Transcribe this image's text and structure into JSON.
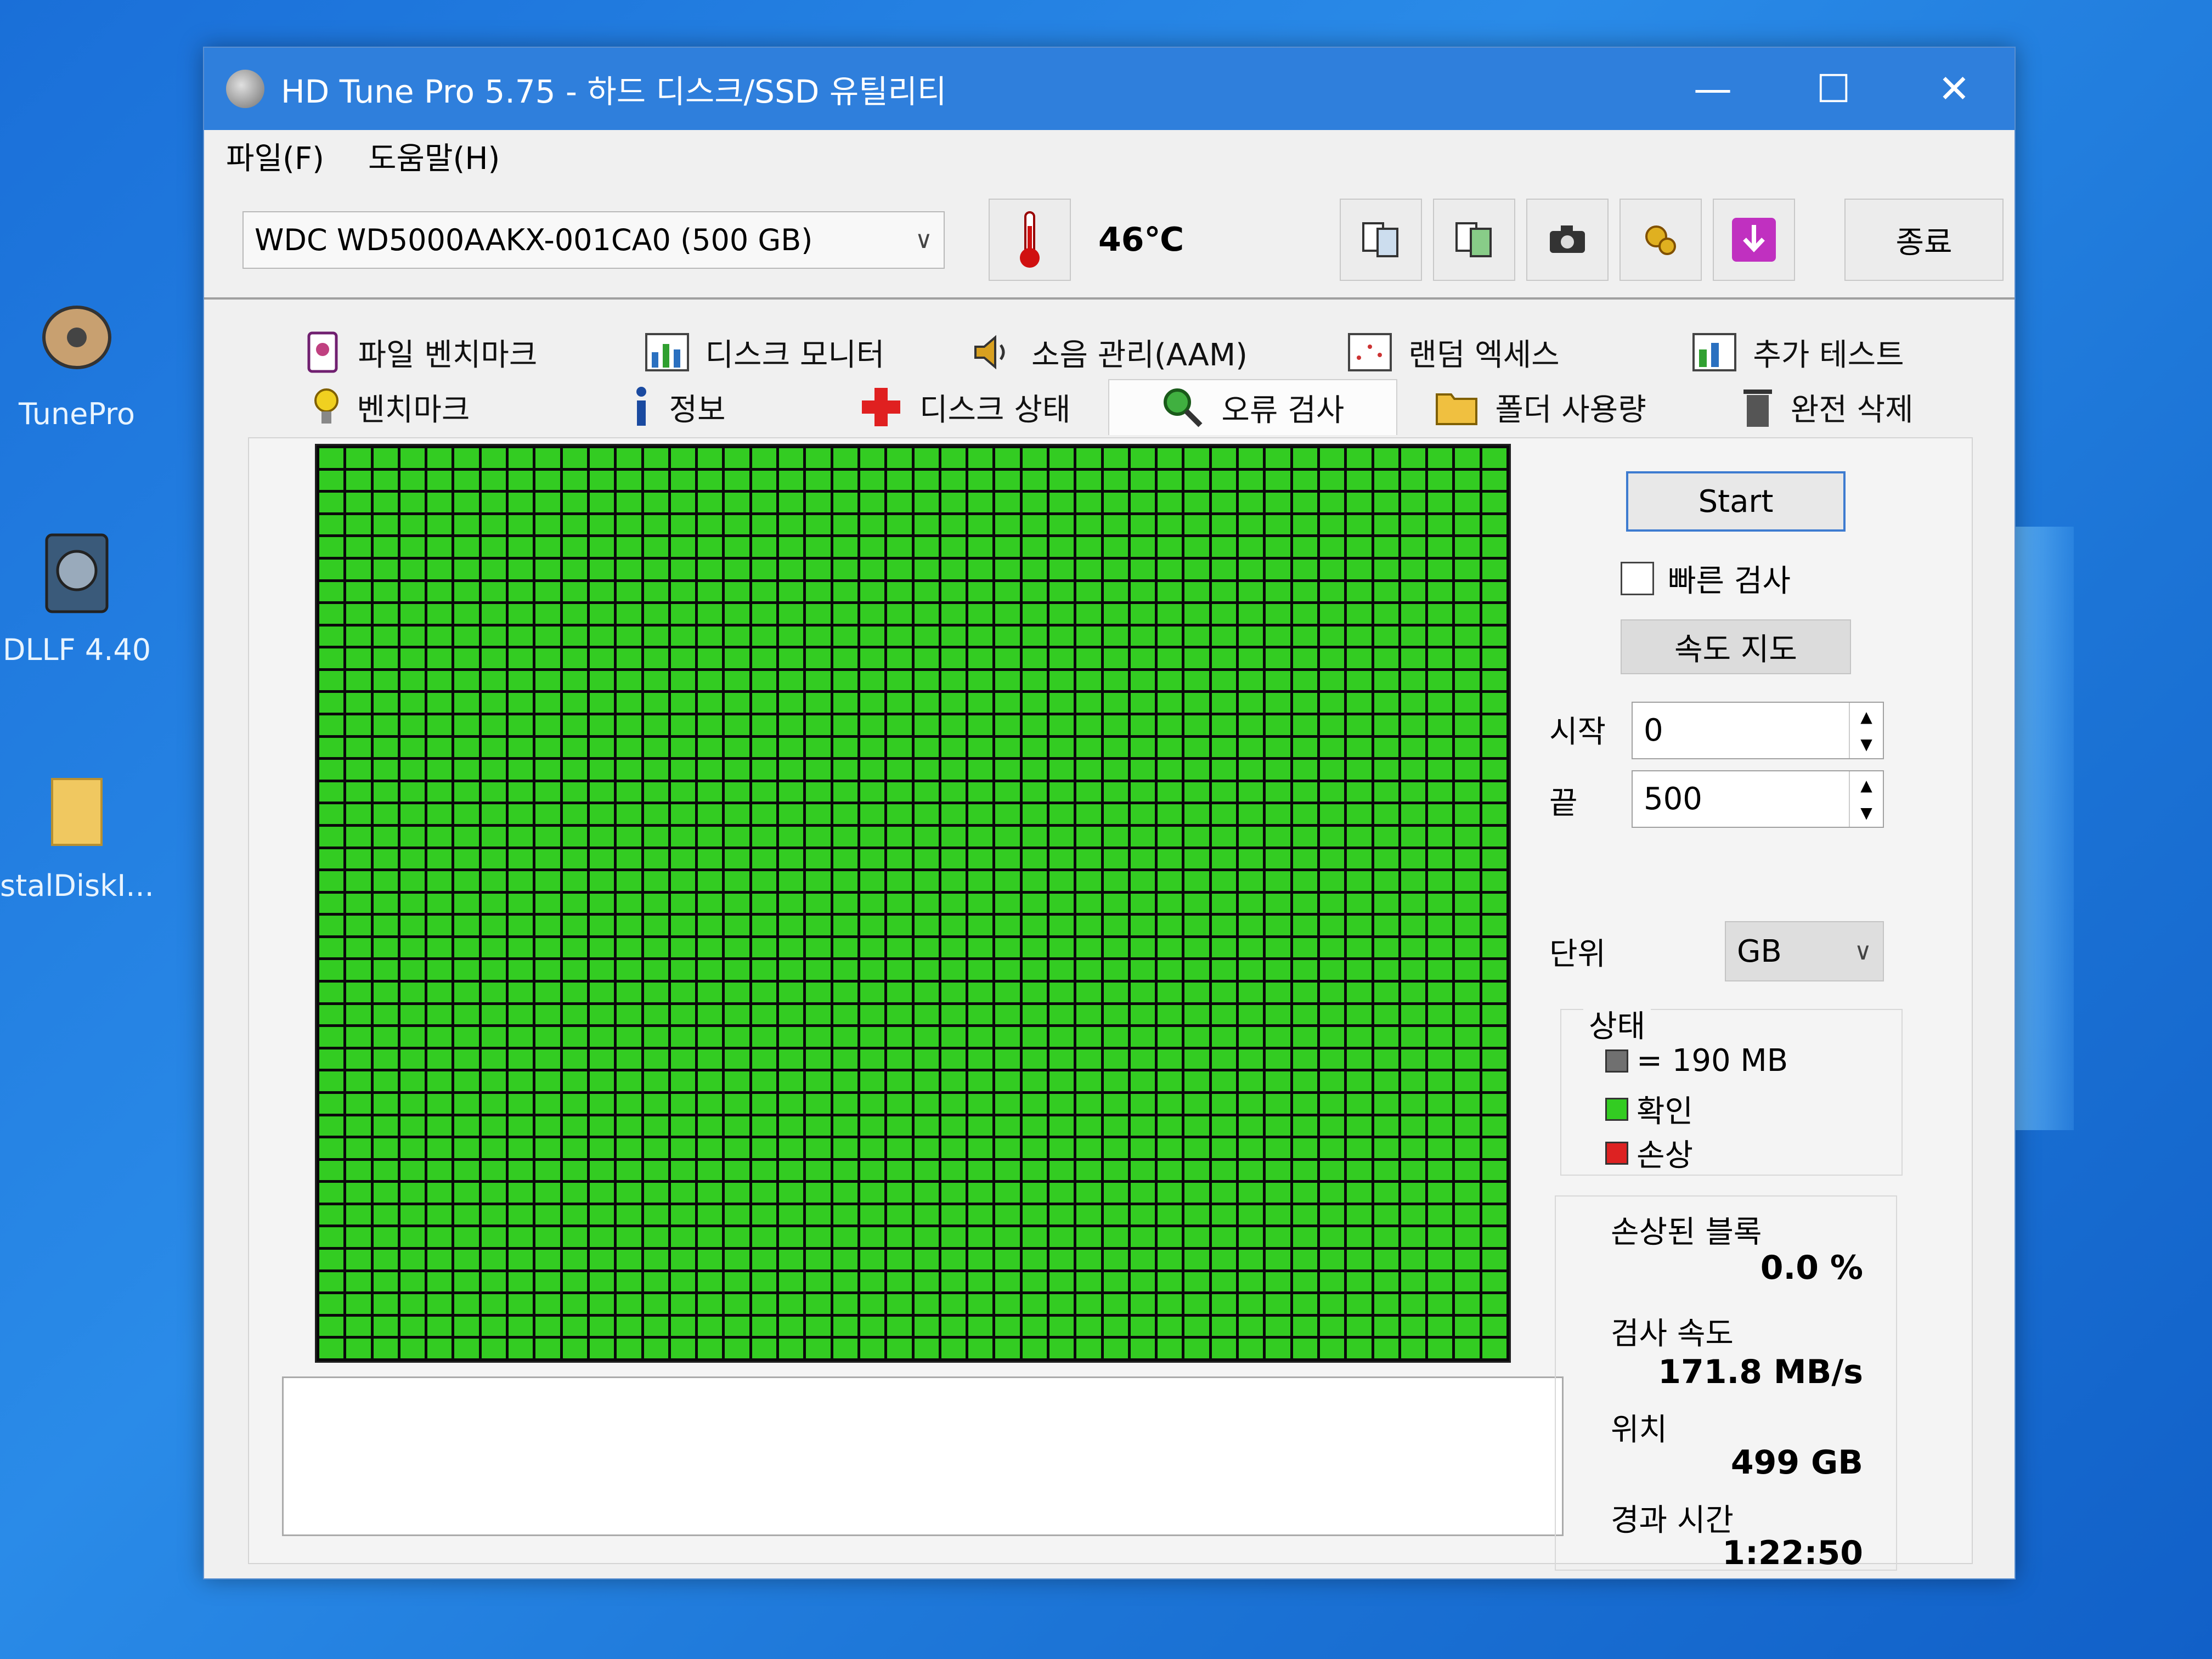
{
  "desktop": {
    "icons": [
      {
        "label": "TunePro",
        "icon": "hard-disk-icon"
      },
      {
        "label": "DLLF 4.40",
        "icon": "disk-utility-icon"
      },
      {
        "label": "stalDiskI...",
        "icon": "folder-icon"
      }
    ]
  },
  "window": {
    "title": "HD Tune Pro 5.75 - 하드 디스크/SSD 유틸리티",
    "minimize": "—",
    "maximize": "☐",
    "close": "✕"
  },
  "menu": {
    "file": "파일(F)",
    "help": "도움말(H)"
  },
  "toolbar": {
    "drive": "WDC WD5000AAKX-001CA0 (500 GB)",
    "temperature": "46℃",
    "exit_label": "종료",
    "buttons": [
      "copy-info-icon",
      "copy-screen-icon",
      "camera-icon",
      "options-icon",
      "download-icon"
    ]
  },
  "tabs": {
    "row1": [
      "파일 벤치마크",
      "디스크 모니터",
      "소음 관리(AAM)",
      "랜덤 엑세스",
      "추가 테스트"
    ],
    "row2": [
      "벤치마크",
      "정보",
      "디스크 상태",
      "오류 검사",
      "폴더 사용량",
      "완전 삭제"
    ],
    "active": "오류 검사"
  },
  "error_scan": {
    "start_label": "Start",
    "quick_scan_label": "빠른 검사",
    "quick_scan_checked": false,
    "speed_map_label": "속도 지도",
    "start_field_label": "시작",
    "start_value": "0",
    "end_field_label": "끝",
    "end_value": "500",
    "unit_label": "단위",
    "unit_value": "GB",
    "status_title": "상태",
    "legend": [
      {
        "label": "= 190 MB",
        "color": "#707070"
      },
      {
        "label": "확인",
        "color": "#33cc22"
      },
      {
        "label": "손상",
        "color": "#dd2222"
      }
    ],
    "damaged_blocks_label": "손상된 블록",
    "damaged_blocks_value": "0.0 %",
    "scan_speed_label": "검사 속도",
    "scan_speed_value": "171.8 MB/s",
    "position_label": "위치",
    "position_value": "499 GB",
    "elapsed_label": "경과 시간",
    "elapsed_value": "1:22:50",
    "block_color_ok": "#33cc22"
  }
}
